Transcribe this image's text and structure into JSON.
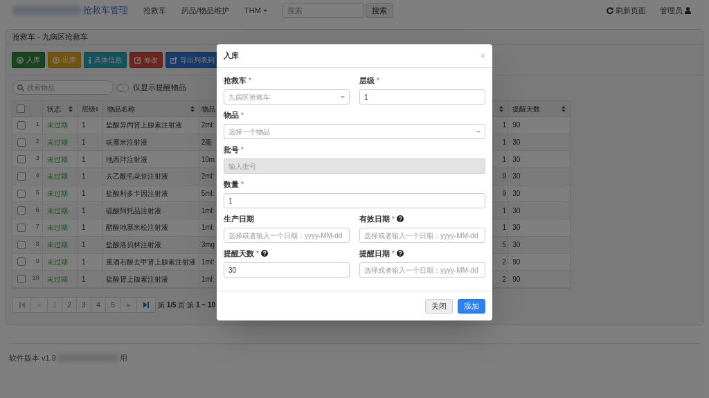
{
  "navbar": {
    "brand": "抢救车管理",
    "items": [
      {
        "label": "抢救车",
        "kind": "link"
      },
      {
        "label": "药品/物品维护",
        "kind": "link"
      },
      {
        "label": "THM",
        "kind": "dropdown"
      }
    ],
    "search": {
      "placeholder": "搜索",
      "button": "搜索"
    },
    "refresh": "刷新页面",
    "user": "管理员"
  },
  "panel": {
    "title": "抢救车 - 九病区抢救车",
    "toolbar": [
      {
        "label": "入库",
        "kind": "in"
      },
      {
        "label": "出库",
        "kind": "out"
      },
      {
        "label": "具体信息",
        "kind": "info"
      },
      {
        "label": "修改",
        "kind": "edit"
      },
      {
        "label": "导出列表到",
        "kind": "export"
      }
    ],
    "search": {
      "placeholder": "搜索物品"
    },
    "toggle": {
      "label": "仅显示提醒物品",
      "on": false
    },
    "table": {
      "header_checked": false,
      "columns": [
        {
          "label": "状态",
          "sortable": true
        },
        {
          "label": "层级",
          "sortable": true
        },
        {
          "label": "物品名称",
          "sortable": true
        },
        {
          "label": "物品",
          "sortable": false
        },
        {
          "sortable": true
        },
        {
          "label": "提醒天数",
          "sortable": true
        }
      ],
      "rows": [
        {
          "checked": false,
          "index": "1",
          "status": "未过期",
          "level": "1",
          "name": "盐酸异丙肾上腺素注射液",
          "spec": "2ml:",
          "column_6": "1",
          "remind_days": "90"
        },
        {
          "checked": false,
          "index": "2",
          "status": "未过期",
          "level": "1",
          "name": "呋塞米注射液",
          "spec": "2毫",
          "column_6": "1",
          "remind_days": "30"
        },
        {
          "checked": false,
          "index": "3",
          "status": "未过期",
          "level": "1",
          "name": "地西泮注射液",
          "spec": "10m",
          "column_6": "1",
          "remind_days": "30"
        },
        {
          "checked": false,
          "index": "4",
          "status": "未过期",
          "level": "1",
          "name": "去乙酰毛花苷注射液",
          "spec": "2ml:",
          "column_6": "9",
          "remind_days": "30"
        },
        {
          "checked": false,
          "index": "5",
          "status": "未过期",
          "level": "1",
          "name": "盐酸利多卡因注射液",
          "spec": "5ml:",
          "column_6": "9",
          "remind_days": "30"
        },
        {
          "checked": false,
          "index": "6",
          "status": "未过期",
          "level": "1",
          "name": "硫酸阿托品注射液",
          "spec": "1ml:",
          "column_6": "1",
          "remind_days": "30"
        },
        {
          "checked": false,
          "index": "7",
          "status": "未过期",
          "level": "1",
          "name": "醋酸地塞米松注射液",
          "spec": "1ml:",
          "column_6": "1",
          "remind_days": "30"
        },
        {
          "checked": false,
          "index": "8",
          "status": "未过期",
          "level": "1",
          "name": "盐酸洛贝林注射液",
          "spec": "3mg",
          "column_6": "5",
          "remind_days": "30"
        },
        {
          "checked": false,
          "index": "9",
          "status": "未过期",
          "level": "1",
          "name": "重酒石酸去甲肾上腺素注射液",
          "spec": "1ml:",
          "column_6": "2",
          "remind_days": "90"
        },
        {
          "checked": false,
          "index": "10",
          "status": "未过期",
          "level": "1",
          "name": "盐酸肾上腺素注射液",
          "spec": "1ml:",
          "column_6": "2",
          "remind_days": "90"
        }
      ]
    },
    "pagination": {
      "items": [
        {
          "kind": "first",
          "disabled": true
        },
        {
          "kind": "prev",
          "label": "«",
          "disabled": true
        },
        {
          "kind": "page",
          "label": "1",
          "disabled": true
        },
        {
          "kind": "page",
          "label": "2",
          "disabled": false
        },
        {
          "kind": "page",
          "label": "3",
          "disabled": false
        },
        {
          "kind": "page",
          "label": "4",
          "disabled": false
        },
        {
          "kind": "page",
          "label": "5",
          "disabled": false
        },
        {
          "kind": "next",
          "label": "»",
          "disabled": false
        },
        {
          "kind": "last",
          "disabled": false
        }
      ],
      "info": "第 **1/5** 页 第 **1 ~ 10**"
    }
  },
  "footer": {
    "version": "软件版本 v1.9",
    "tail": "用"
  },
  "modal": {
    "title": "入库",
    "close": "×",
    "fields": [
      {
        "kind": "select",
        "half": true,
        "label": "抢救车",
        "mark": "*",
        "help": false,
        "value": "九病区抢救车",
        "disabled": true
      },
      {
        "kind": "input",
        "half": true,
        "label": "层级",
        "mark": "*",
        "help": false,
        "value": "1",
        "disabled": false
      },
      {
        "kind": "select",
        "half": false,
        "label": "物品",
        "mark": "*",
        "help": false,
        "placeholder": "选择一个物品",
        "disabled": false
      },
      {
        "kind": "input",
        "half": false,
        "label": "批号",
        "mark": "*",
        "help": false,
        "placeholder": "输入批号",
        "disabled": true
      },
      {
        "kind": "input",
        "half": false,
        "label": "数量",
        "mark": "*",
        "help": false,
        "value": "1",
        "disabled": false
      },
      {
        "kind": "input",
        "half": true,
        "label": "生产日期",
        "help": false,
        "placeholder": "选择或者输入一个日期：yyyy-MM-dd",
        "disabled": false
      },
      {
        "kind": "input",
        "half": true,
        "label": "有效日期",
        "mark": "*",
        "help": true,
        "placeholder": "选择或者输入一个日期：yyyy-MM-dd",
        "disabled": false
      },
      {
        "kind": "input",
        "half": true,
        "label": "提醒天数",
        "mark": "*",
        "help": true,
        "value": "30",
        "disabled": false
      },
      {
        "kind": "input",
        "half": true,
        "label": "提醒日期",
        "mark": "*",
        "help": true,
        "placeholder": "选择或者输入一个日期：yyyy-MM-dd",
        "disabled": false
      }
    ],
    "buttons": [
      {
        "label": "关闭",
        "kind": "default"
      },
      {
        "label": "添加",
        "kind": "primary"
      }
    ]
  }
}
